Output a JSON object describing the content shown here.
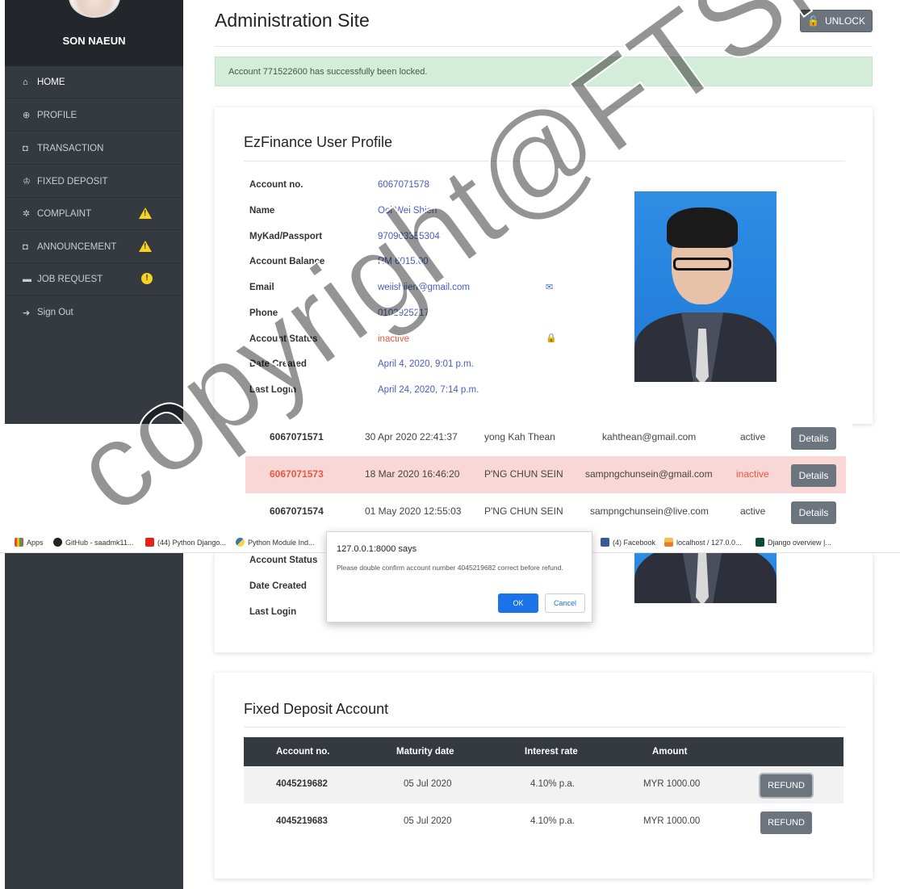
{
  "sidebar": {
    "user_name": "SON NAEUN",
    "items": [
      {
        "label": "HOME",
        "icon": "home-icon"
      },
      {
        "label": "PROFILE",
        "icon": "globe-icon"
      },
      {
        "label": "TRANSACTION",
        "icon": "gift-icon"
      },
      {
        "label": "FIXED DEPOSIT",
        "icon": "trophy-icon"
      },
      {
        "label": "COMPLAINT",
        "icon": "gear-icon"
      },
      {
        "label": "ANNOUNCEMENT",
        "icon": "gift-icon"
      },
      {
        "label": "JOB REQUEST",
        "icon": "briefcase-icon"
      },
      {
        "label": "Sign Out",
        "icon": "sign-out-icon"
      }
    ]
  },
  "header": {
    "title": "Administration Site",
    "unlock_label": "UNLOCK"
  },
  "alert": "Account 771522600 has successfully been locked.",
  "profile": {
    "heading": "EzFinance User Profile",
    "fields": [
      {
        "label": "Account no.",
        "value": "6067071578"
      },
      {
        "label": "Name",
        "value": "Ooi Wei Shien"
      },
      {
        "label": "MyKad/Passport",
        "value": "970903355304"
      },
      {
        "label": "Account Balance",
        "value": "RM 6015.00"
      },
      {
        "label": "Email",
        "value": "weiishiien@gmail.com"
      },
      {
        "label": "Phone",
        "value": "0102925217"
      },
      {
        "label": "Account Status",
        "value": "inactive"
      },
      {
        "label": "Date Created",
        "value": "April 4, 2020, 9:01 p.m."
      },
      {
        "label": "Last Login",
        "value": "April 24, 2020, 7:14 p.m."
      }
    ]
  },
  "user_list": [
    {
      "account": "6067071571",
      "date": "30 Apr 2020 22:41:37",
      "name": "yong Kah Thean",
      "email": "kahthean@gmail.com",
      "status": "active",
      "action": "Details"
    },
    {
      "account": "6067071573",
      "date": "18 Mar 2020 16:46:20",
      "name": "P'NG CHUN SEIN",
      "email": "sampngchunsein@gmail.com",
      "status": "inactive",
      "action": "Details"
    },
    {
      "account": "6067071574",
      "date": "01 May 2020 12:55:03",
      "name": "P'NG CHUN SEIN",
      "email": "sampngchunsein@live.com",
      "status": "active",
      "action": "Details"
    }
  ],
  "bookmarks": [
    {
      "label": "Apps"
    },
    {
      "label": "GitHub - saadmk11..."
    },
    {
      "label": "(44) Python Django..."
    },
    {
      "label": "Python Module Ind..."
    },
    {
      "label": "(4) Facebook"
    },
    {
      "label": "localhost / 127.0.0..."
    },
    {
      "label": "Django overview |..."
    }
  ],
  "dialog": {
    "title": "127.0.0.1:8000 says",
    "message": "Please double confirm account number 4045219682 correct before refund.",
    "ok": "OK",
    "cancel": "Cancel"
  },
  "profile_lower_labels": [
    "Account Status",
    "Date Created",
    "Last Login"
  ],
  "fixed_deposit": {
    "heading": "Fixed Deposit Account",
    "columns": [
      "Account no.",
      "Maturity date",
      "Interest rate",
      "Amount"
    ],
    "rows": [
      {
        "account": "4045219682",
        "maturity": "05 Jul 2020",
        "rate": "4.10% p.a.",
        "amount": "MYR 1000.00",
        "action": "REFUND"
      },
      {
        "account": "4045219683",
        "maturity": "05 Jul 2020",
        "rate": "4.10% p.a.",
        "amount": "MYR 1000.00",
        "action": "REFUND"
      }
    ]
  },
  "watermark": "copyright@FTSM",
  "colors": {
    "sidebar": "#343a40",
    "link_blue": "#4a5bc1",
    "inactive_red": "#e45a3c",
    "alert_green": "#d4edda",
    "button_gray": "#6c757d",
    "warning_yellow": "#f8d21d"
  }
}
